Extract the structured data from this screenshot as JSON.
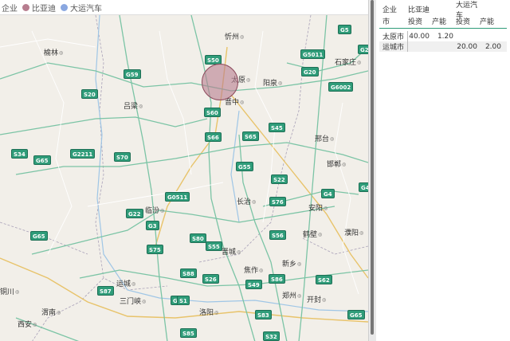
{
  "legend": {
    "field_label": "企业",
    "series": [
      {
        "name": "比亚迪",
        "color": "#b77d8f"
      },
      {
        "name": "大运汽车",
        "color": "#8aa7e0"
      }
    ]
  },
  "map": {
    "cities": [
      "忻州",
      "石家庄",
      "榆林",
      "太原",
      "阳泉",
      "吕梁",
      "晋中",
      "邢台",
      "邯郸",
      "长治",
      "安阳",
      "临汾",
      "鹤壁",
      "濮阳",
      "晋城",
      "新乡",
      "焦作",
      "运城",
      "三门峡",
      "郑州",
      "开封",
      "渭南",
      "洛阳",
      "西安",
      "铜川"
    ],
    "highways": [
      "G5",
      "G55",
      "G25",
      "G5011",
      "G59",
      "S20",
      "G20",
      "S50",
      "S60",
      "S45",
      "S66",
      "S65",
      "G65",
      "G2211",
      "S70",
      "S34",
      "S22",
      "G4",
      "G45",
      "G22",
      "S76",
      "S80",
      "S56",
      "S75",
      "S85",
      "S88",
      "G30",
      "G65",
      "S49",
      "S86",
      "S87",
      "S26",
      "S62",
      "G0511",
      "S83",
      "S55",
      "S1",
      "G3",
      "G6002",
      "S32",
      "G65"
    ]
  },
  "bubble": {
    "city": "太原",
    "series": "比亚迪",
    "color": "#b77d8f"
  },
  "table": {
    "header_row1": [
      "企业",
      "比亚迪",
      "",
      "大运汽车",
      ""
    ],
    "header_row2": [
      "市",
      "投资",
      "产能",
      "投资",
      "产能"
    ],
    "rows": [
      {
        "city": "太原市",
        "byd_invest": "40.00",
        "byd_capacity": "1.20",
        "dy_invest": "",
        "dy_capacity": ""
      },
      {
        "city": "运城市",
        "byd_invest": "",
        "byd_capacity": "",
        "dy_invest": "20.00",
        "dy_capacity": "2.00"
      }
    ]
  }
}
